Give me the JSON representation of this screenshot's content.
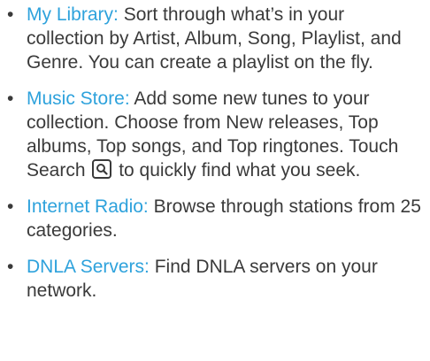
{
  "items": [
    {
      "term": "My Library:",
      "text": " Sort through what’s in your collection by Artist, Album, Song, Playlist, and Genre. You can create a playlist on the fly."
    },
    {
      "term": "Music Store:",
      "text_before": " Add some new tunes to your collection. Choose from New releases, Top albums, Top songs, and Top ringtones. Touch Search ",
      "text_after": " to quickly find what you seek.",
      "icon": "search-icon"
    },
    {
      "term": "Internet Radio:",
      "text": " Browse through stations from 25 categories."
    },
    {
      "term": "DNLA Servers:",
      "text": " Find DNLA servers on your network."
    }
  ],
  "bullet": "•",
  "colors": {
    "term": "#2ea2dc",
    "text": "#3a3a3a"
  }
}
